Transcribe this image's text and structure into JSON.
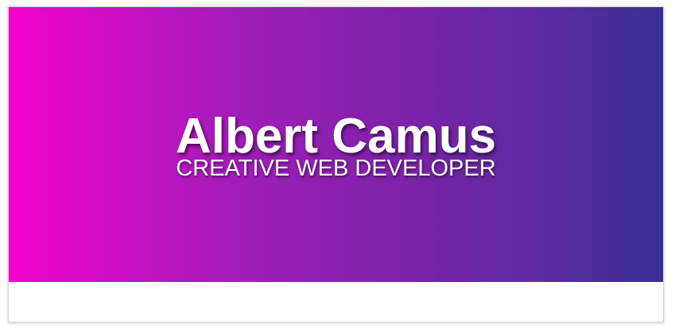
{
  "hero": {
    "name": "Albert Camus",
    "role": "CREATIVE WEB DEVELOPER",
    "gradient_colors": [
      "#f402cc",
      "#a11db9",
      "#7a24a8",
      "#3b2f96"
    ],
    "text_color": "#ffffff"
  }
}
